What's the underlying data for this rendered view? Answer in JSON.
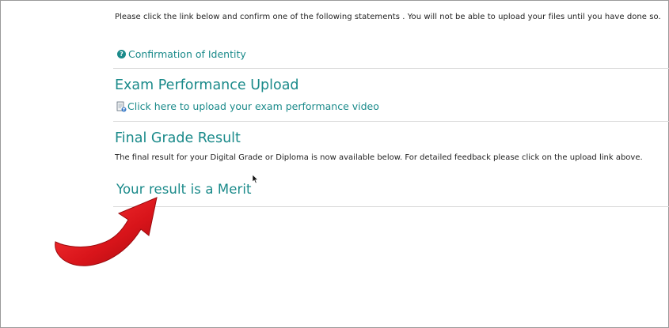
{
  "intro_text": "Please click the link below and confirm one of the following statements . You will not be able to upload your files until you have done so.",
  "identity": {
    "icon": "question-circle-icon",
    "link_label": "Confirmation of Identity"
  },
  "upload_section": {
    "heading": "Exam Performance Upload",
    "icon": "document-upload-icon",
    "link_label": "Click here to upload your exam performance video"
  },
  "final_section": {
    "heading": "Final Grade Result",
    "description": "The final result for your Digital Grade or Diploma is now available below. For detailed feedback please click on the upload link above.",
    "result_text": "Your result is a Merit"
  },
  "annotation": {
    "arrow_color": "#d8141a",
    "arrow_icon": "red-curved-arrow"
  },
  "colors": {
    "accent": "#1a8a8a",
    "divider": "#d8d8d8",
    "text": "#222222"
  }
}
